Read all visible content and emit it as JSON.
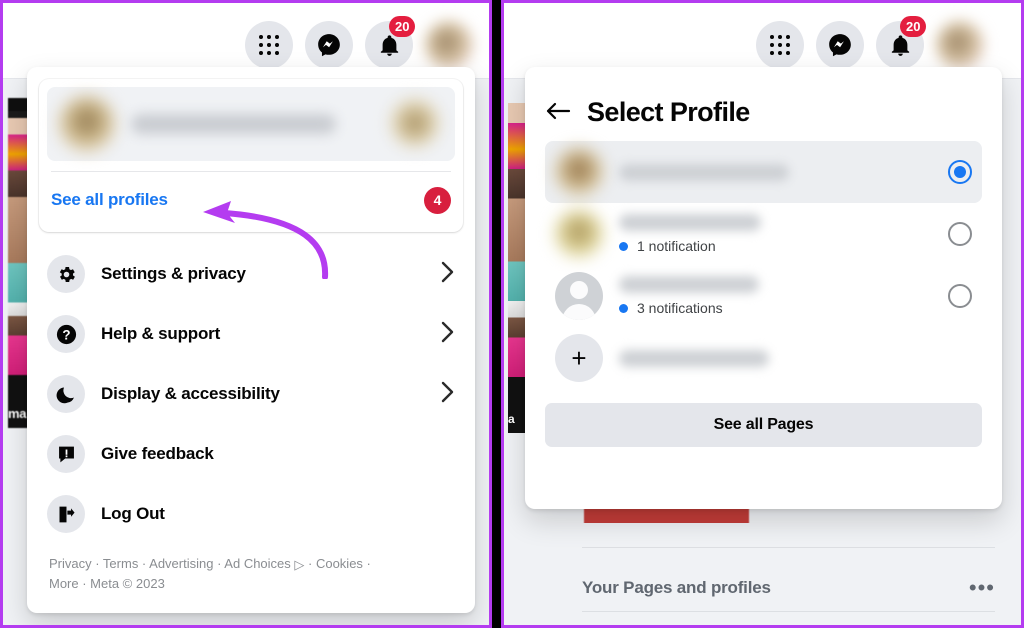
{
  "theme": {
    "accent_blue": "#1877f2",
    "badge_red": "#e41e3f",
    "badge_red_small": "#d81f3e",
    "annotation_purple": "#b43cf0",
    "chip_grey": "#e4e6eb",
    "page_grey": "#f0f2f5"
  },
  "header": {
    "menu_icon": "grid-apps-icon",
    "messenger_icon": "messenger-icon",
    "notifications_icon": "bell-icon",
    "notifications_count": "20",
    "account_avatar": "account-avatar"
  },
  "left_panel": {
    "profile_card": {
      "avatar": "profile-avatar-blurred",
      "name": "",
      "secondary_avatar": "secondary-avatar-blurred",
      "see_all_profiles_label": "See all profiles",
      "profiles_badge_count": "4"
    },
    "menu_items": [
      {
        "icon": "gear-icon",
        "label": "Settings & privacy",
        "has_chevron": true
      },
      {
        "icon": "question-icon",
        "label": "Help & support",
        "has_chevron": true
      },
      {
        "icon": "moon-icon",
        "label": "Display & accessibility",
        "has_chevron": true
      },
      {
        "icon": "feedback-icon",
        "label": "Give feedback",
        "has_chevron": false
      },
      {
        "icon": "logout-icon",
        "label": "Log Out",
        "has_chevron": false
      }
    ],
    "footer": {
      "line1_part1": "Privacy · Terms · Advertising · Ad Choices ",
      "line1_glyph": "▷",
      "line1_part2": " · Cookies ·",
      "line2": "More · Meta © 2023"
    }
  },
  "right_panel": {
    "back_icon": "back-arrow-icon",
    "title": "Select Profile",
    "profiles": [
      {
        "avatar": "profile-avatar-blurred",
        "name": "",
        "note": "",
        "selected": true,
        "name_width": "w1"
      },
      {
        "avatar": "page-avatar-blurred",
        "name": "",
        "note": "1 notification",
        "selected": false,
        "name_width": "w2"
      },
      {
        "avatar": "generic-avatar",
        "name": "",
        "note": "3 notifications",
        "selected": false,
        "name_width": "w3"
      }
    ],
    "create_row": {
      "icon": "plus-icon",
      "label": "",
      "name_width": "w4"
    },
    "see_all_pages_label": "See all Pages",
    "background": {
      "section_title": "Your Pages and profiles",
      "overflow_icon": "more-horizontal-icon"
    }
  },
  "annotation": {
    "arrow": "curved-arrow-pointing-to-see-all-profiles",
    "color": "#b43cf0"
  }
}
